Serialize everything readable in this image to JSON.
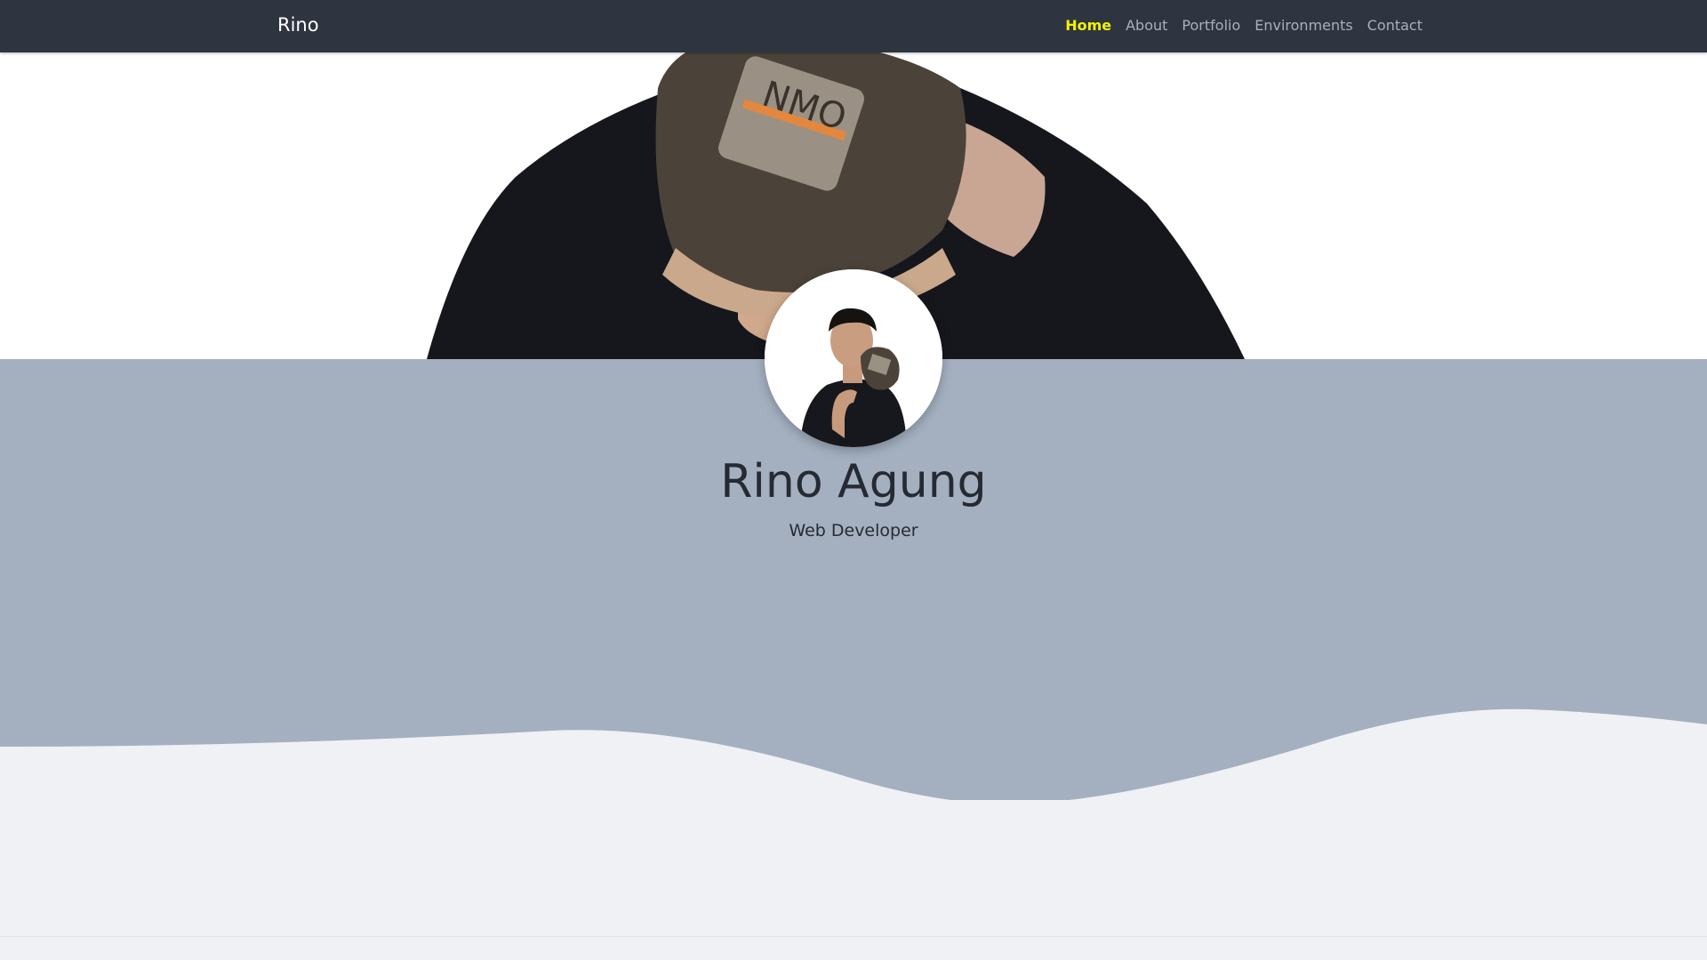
{
  "navbar": {
    "brand": "Rino",
    "links": [
      {
        "label": "Home",
        "active": true
      },
      {
        "label": "About",
        "active": false
      },
      {
        "label": "Portfolio",
        "active": false
      },
      {
        "label": "Environments",
        "active": false
      },
      {
        "label": "Contact",
        "active": false
      }
    ]
  },
  "profile": {
    "name": "Rino Agung",
    "role": "Web Developer"
  },
  "colors": {
    "navbar_bg": "#2e3440",
    "active_link": "#f2f200",
    "nav_link": "#a9b0bb",
    "section_bg": "#a4b0c0",
    "page_bg": "#eff1f5"
  }
}
